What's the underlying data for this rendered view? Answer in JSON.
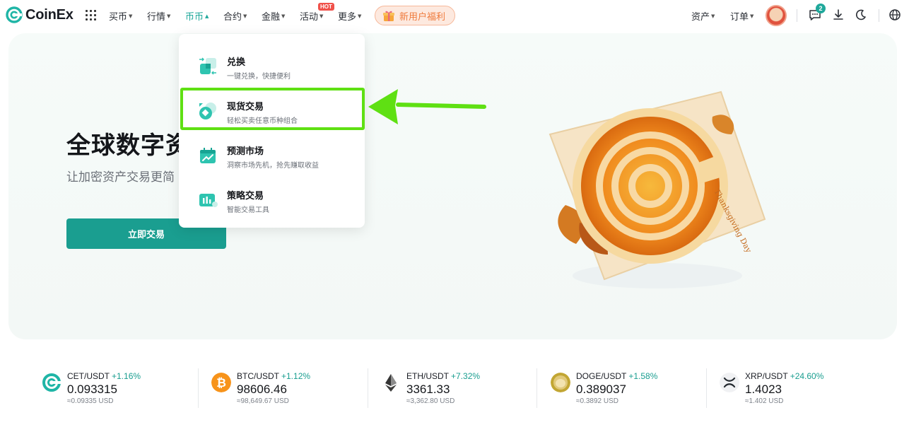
{
  "header": {
    "brand": "CoinEx",
    "nav": [
      {
        "label": "买币"
      },
      {
        "label": "行情"
      },
      {
        "label": "币币"
      },
      {
        "label": "合约"
      },
      {
        "label": "金融"
      },
      {
        "label": "活动"
      },
      {
        "label": "更多"
      }
    ],
    "hot_badge": "HOT",
    "new_user": "新用户福利",
    "assets": "资产",
    "orders": "订单",
    "notif_count": "2"
  },
  "hero": {
    "title": "全球数字资",
    "subtitle": "让加密资产交易更简",
    "cta": "立即交易",
    "banner_text": "Thanksgiving Day"
  },
  "dropdown": {
    "items": [
      {
        "title": "兑换",
        "desc": "一键兑换，快捷便利"
      },
      {
        "title": "现货交易",
        "desc": "轻松买卖任意币种组合"
      },
      {
        "title": "预测市场",
        "desc": "洞察市场先机，抢先赚取收益"
      },
      {
        "title": "策略交易",
        "desc": "智能交易工具"
      }
    ]
  },
  "ticker": [
    {
      "pair": "CET/USDT",
      "change": "+1.16%",
      "price": "0.093315",
      "usd": "≈0.09335 USD",
      "icon": "cet-icon"
    },
    {
      "pair": "BTC/USDT",
      "change": "+1.12%",
      "price": "98606.46",
      "usd": "≈98,649.67 USD",
      "icon": "btc-icon"
    },
    {
      "pair": "ETH/USDT",
      "change": "+7.32%",
      "price": "3361.33",
      "usd": "≈3,362.80 USD",
      "icon": "eth-icon"
    },
    {
      "pair": "DOGE/USDT",
      "change": "+1.58%",
      "price": "0.389037",
      "usd": "≈0.3892 USD",
      "icon": "doge-icon"
    },
    {
      "pair": "XRP/USDT",
      "change": "+24.60%",
      "price": "1.4023",
      "usd": "≈1.402 USD",
      "icon": "xrp-icon"
    }
  ],
  "colors": {
    "brand": "#1a9e90",
    "positive": "#1a9e90",
    "highlight": "#5fe013"
  }
}
